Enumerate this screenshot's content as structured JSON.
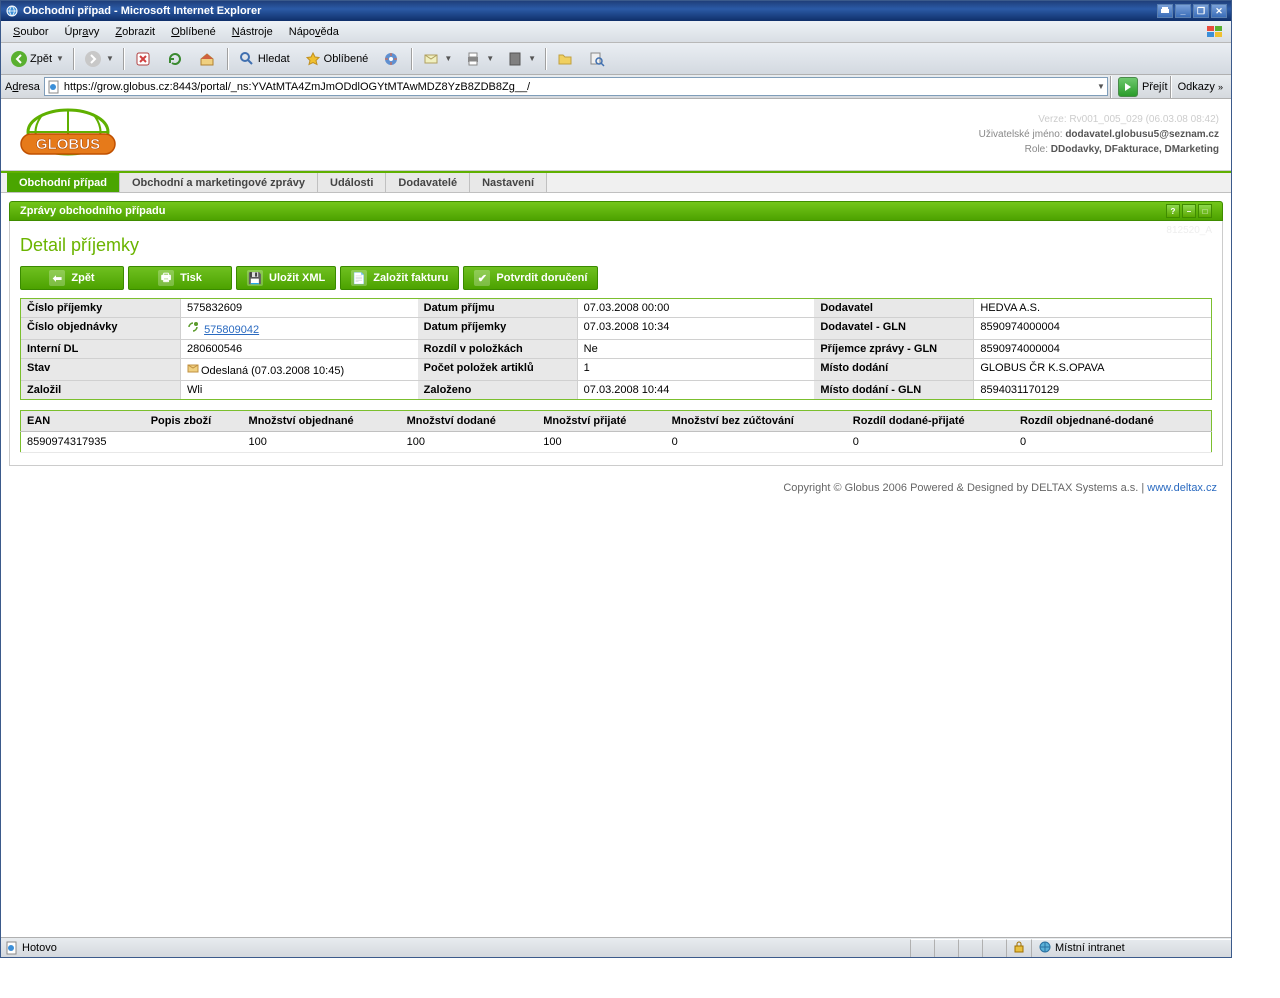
{
  "window": {
    "title": "Obchodní případ - Microsoft Internet Explorer"
  },
  "menu": {
    "soubor": "Soubor",
    "upravy": "Úpravy",
    "zobrazit": "Zobrazit",
    "oblibene": "Oblíbené",
    "nastroje": "Nástroje",
    "napoveda": "Nápověda"
  },
  "toolbar": {
    "back": "Zpět",
    "search": "Hledat",
    "fav": "Oblíbené"
  },
  "address": {
    "label": "Adresa",
    "url": "https://grow.globus.cz:8443/portal/_ns:YVAtMTA4ZmJmODdlOGYtMTAwMDZ8YzB8ZDB8Zg__/",
    "go": "Přejít",
    "links": "Odkazy"
  },
  "header": {
    "version": "Verze: Rv001_005_029 (06.03.08 08:42)",
    "userLabel": "Uživatelské jméno:",
    "user": "dodavatel.globusu5@seznam.cz",
    "roleLabel": "Role:",
    "role": "DDodavky, DFakturace, DMarketing"
  },
  "nav": {
    "t1": "Obchodní případ",
    "t2": "Obchodní a marketingové zprávy",
    "t3": "Události",
    "t4": "Dodavatelé",
    "t5": "Nastavení"
  },
  "sectionHeader": "Zprávy obchodního případu",
  "pageTitle": "Detail příjemky",
  "watermark": "812520_A",
  "buttons": {
    "back": "Zpět",
    "print": "Tisk",
    "saveXml": "Uložit XML",
    "invoice": "Založit fakturu",
    "confirm": "Potvrdit doručení"
  },
  "labels": {
    "cisloPrijemky": "Číslo příjemky",
    "cisloObj": "Číslo objednávky",
    "interniDL": "Interní DL",
    "stav": "Stav",
    "zalozil": "Založil",
    "datumPrijmu": "Datum příjmu",
    "datumPrijemky": "Datum příjemky",
    "rozdilPol": "Rozdíl v položkách",
    "pocetArt": "Počet položek artiklů",
    "zalozeno": "Založeno",
    "dodavatel": "Dodavatel",
    "dodavatelGln": "Dodavatel - GLN",
    "prijemceGln": "Příjemce zprávy - GLN",
    "mistoDodani": "Místo dodání",
    "mistoDodaniGln": "Místo dodání - GLN"
  },
  "values": {
    "cisloPrijemky": "575832609",
    "cisloObj": "575809042",
    "interniDL": "280600546",
    "stav": "Odeslaná (07.03.2008 10:45)",
    "zalozil": "Wli",
    "datumPrijmu": "07.03.2008 00:00",
    "datumPrijemky": "07.03.2008 10:34",
    "rozdilPol": "Ne",
    "pocetArt": "1",
    "zalozeno": "07.03.2008 10:44",
    "dodavatel": "HEDVA A.S.",
    "dodavatelGln": "8590974000004",
    "prijemceGln": "8590974000004",
    "mistoDodani": "GLOBUS ČR K.S.OPAVA",
    "mistoDodaniGln": "8594031170129"
  },
  "cols": {
    "ean": "EAN",
    "popis": "Popis zboží",
    "mnozObj": "Množství objednané",
    "mnozDod": "Množství dodané",
    "mnozPrij": "Množství přijaté",
    "mnozBez": "Množství bez zúčtování",
    "rozdilDP": "Rozdíl dodané-přijaté",
    "rozdilOD": "Rozdíl objednané-dodané"
  },
  "rows": [
    {
      "ean": "8590974317935",
      "popis": "",
      "mnozObj": "100",
      "mnozDod": "100",
      "mnozPrij": "100",
      "mnozBez": "0",
      "rozdilDP": "0",
      "rozdilOD": "0"
    }
  ],
  "footer": {
    "copy": "Copyright © Globus 2006 Powered & Designed by DELTAX Systems a.s. | ",
    "linkText": "www.deltax.cz"
  },
  "status": {
    "hotovo": "Hotovo",
    "zone": "Místní intranet"
  }
}
